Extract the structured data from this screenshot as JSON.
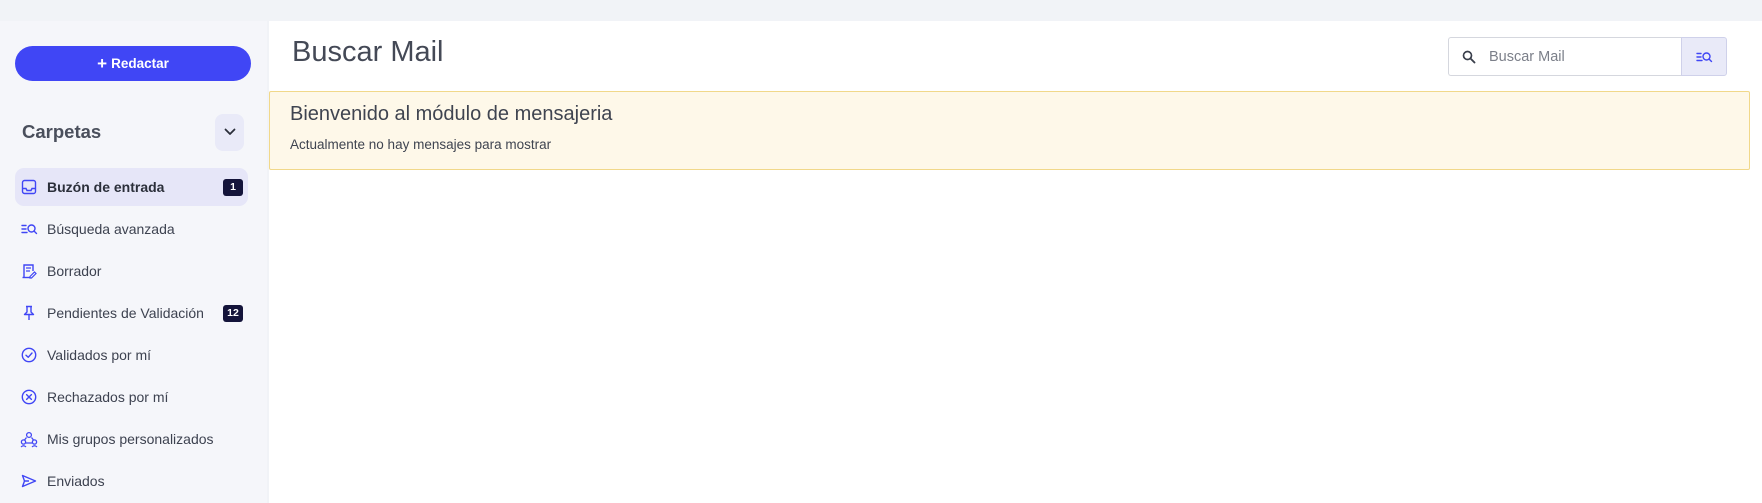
{
  "sidebar": {
    "compose_label": "Redactar",
    "folders_title": "Carpetas",
    "items": [
      {
        "label": "Buzón de entrada",
        "icon": "inbox-icon",
        "badge": "1",
        "active": true
      },
      {
        "label": "Búsqueda avanzada",
        "icon": "advanced-search-icon",
        "badge": null,
        "active": false
      },
      {
        "label": "Borrador",
        "icon": "draft-icon",
        "badge": null,
        "active": false
      },
      {
        "label": "Pendientes de Validación",
        "icon": "pin-icon",
        "badge": "12",
        "active": false
      },
      {
        "label": "Validados por mí",
        "icon": "check-circle-icon",
        "badge": null,
        "active": false
      },
      {
        "label": "Rechazados por mí",
        "icon": "x-circle-icon",
        "badge": null,
        "active": false
      },
      {
        "label": "Mis grupos personalizados",
        "icon": "groups-icon",
        "badge": null,
        "active": false
      },
      {
        "label": "Enviados",
        "icon": "send-icon",
        "badge": null,
        "active": false
      }
    ]
  },
  "main": {
    "title": "Buscar Mail",
    "search": {
      "placeholder": "Buscar Mail",
      "value": ""
    },
    "alert": {
      "title": "Bienvenido al módulo de mensajeria",
      "text": "Actualmente no hay mensajes para mostrar"
    }
  },
  "colors": {
    "accent": "#4046f5",
    "badge": "#14143a",
    "alert_bg": "#fef8e9",
    "alert_border": "#f1d88a",
    "active_item_bg": "#e6e6f8"
  }
}
